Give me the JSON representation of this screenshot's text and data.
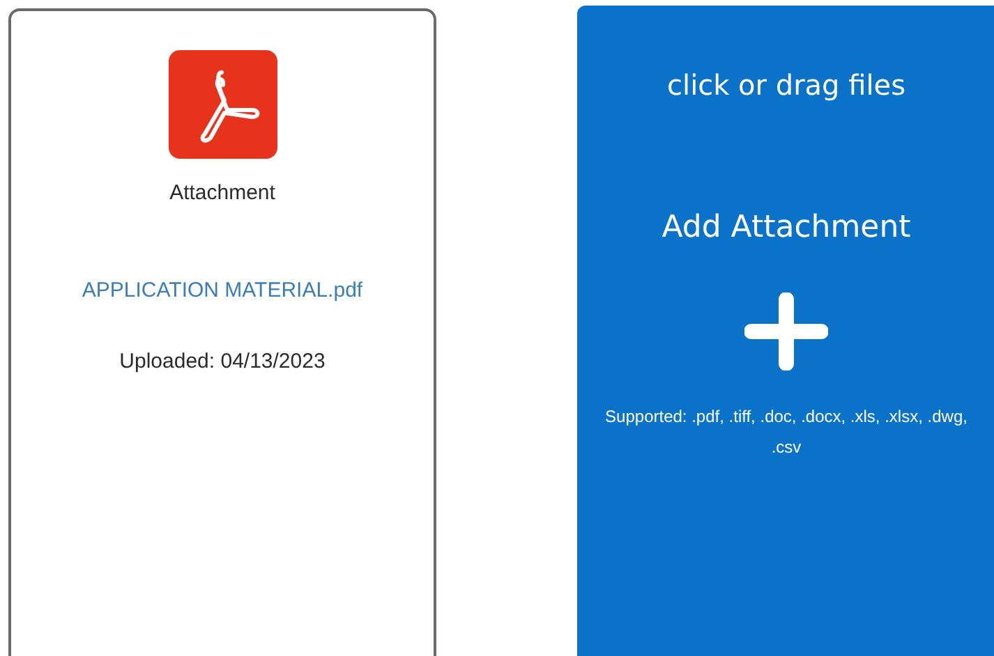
{
  "attachment_card": {
    "label": "Attachment",
    "file_name": "APPLICATION MATERIAL.pdf",
    "uploaded": "Uploaded: 04/13/2023"
  },
  "upload_area": {
    "hint": "click or drag files",
    "title": "Add Attachment",
    "supported": "Supported: .pdf, .tiff, .doc, .docx, .xls, .xlsx, .dwg, .csv"
  }
}
